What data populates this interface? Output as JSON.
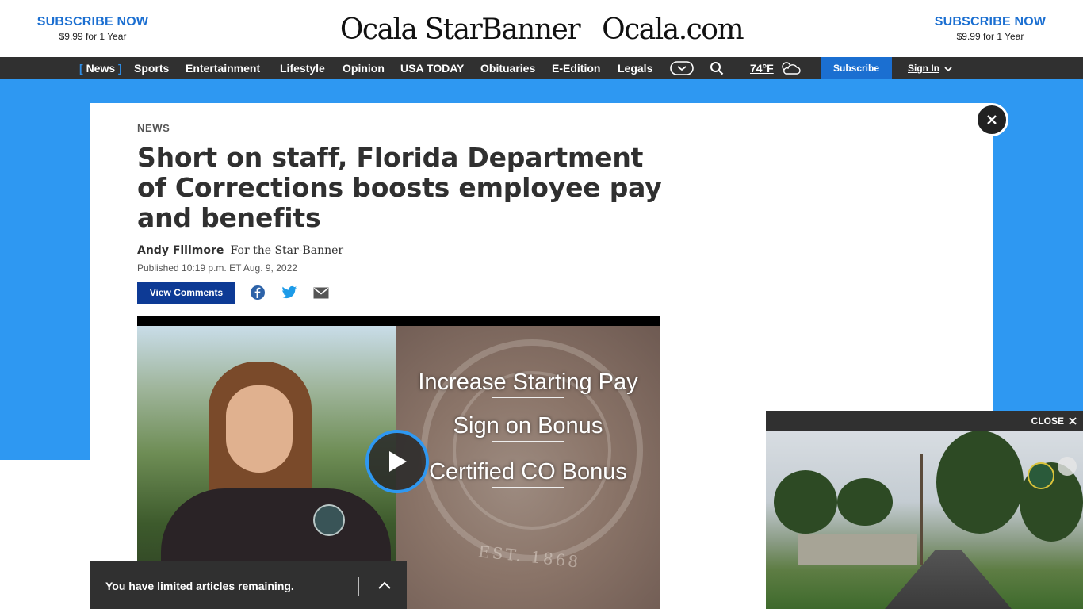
{
  "masthead": {
    "subscribe_left": {
      "title": "SUBSCRIBE NOW",
      "price": "$9.99 for 1 Year"
    },
    "subscribe_right": {
      "title": "SUBSCRIBE NOW",
      "price": "$9.99 for 1 Year"
    },
    "logo_left": "Ocala StarBanner",
    "logo_right": "Ocala.com"
  },
  "nav": {
    "items": [
      {
        "label": "News",
        "active": true
      },
      {
        "label": "Sports"
      },
      {
        "label": "Entertainment"
      },
      {
        "label": "Lifestyle"
      },
      {
        "label": "Opinion"
      },
      {
        "label": "USA TODAY"
      },
      {
        "label": "Obituaries"
      },
      {
        "label": "E-Edition"
      },
      {
        "label": "Legals"
      }
    ],
    "active_bracket_open": "[",
    "active_bracket_close": "]",
    "weather_temp": "74°F",
    "subscribe_label": "Subscribe",
    "signin_label": "Sign In",
    "icons": [
      "more-chevron-icon",
      "search-icon",
      "weather-cloud-icon",
      "chevron-down-icon"
    ]
  },
  "article": {
    "kicker": "NEWS",
    "headline": "Short on staff, Florida Department of Corrections boosts employee pay and benefits",
    "author": "Andy Fillmore",
    "affiliation": "For the Star-Banner",
    "published": "Published 10:19 p.m. ET Aug. 9, 2022",
    "comments_label": "View Comments",
    "share_icons": [
      "facebook-icon",
      "twitter-icon",
      "email-icon"
    ]
  },
  "video": {
    "lines": [
      "Increase Starting Pay",
      "Sign on Bonus",
      "Certified CO Bonus"
    ],
    "seal_text": "EST. 1868"
  },
  "limited_bar": {
    "text": "You have limited articles remaining."
  },
  "floating_video": {
    "close_label": "CLOSE"
  },
  "colors": {
    "brand_blue": "#2e98f2",
    "subscribe_blue": "#1b6fd1",
    "button_navy": "#0d3a95",
    "nav_dark": "#303030"
  }
}
